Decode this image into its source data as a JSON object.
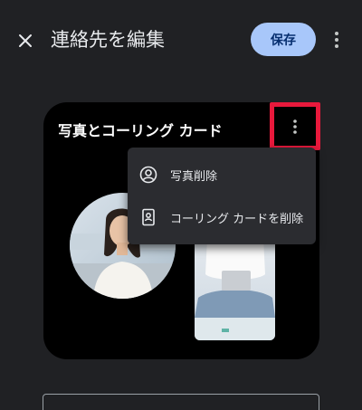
{
  "app_bar": {
    "close_icon": "close-icon",
    "title": "連絡先を編集",
    "save_label": "保存",
    "overflow_icon": "more-vert-icon"
  },
  "colors": {
    "background": "#202124",
    "save_button": "#a8c7fa",
    "card": "#000000",
    "menu": "#2b2c30",
    "highlight": "#e8193c"
  },
  "card": {
    "title": "写真とコーリング カード",
    "more_icon": "more-vert-icon"
  },
  "menu": {
    "items": [
      {
        "icon": "account-circle-icon",
        "label": "写真削除"
      },
      {
        "icon": "contact-card-icon",
        "label": "コーリング カードを削除"
      }
    ]
  }
}
